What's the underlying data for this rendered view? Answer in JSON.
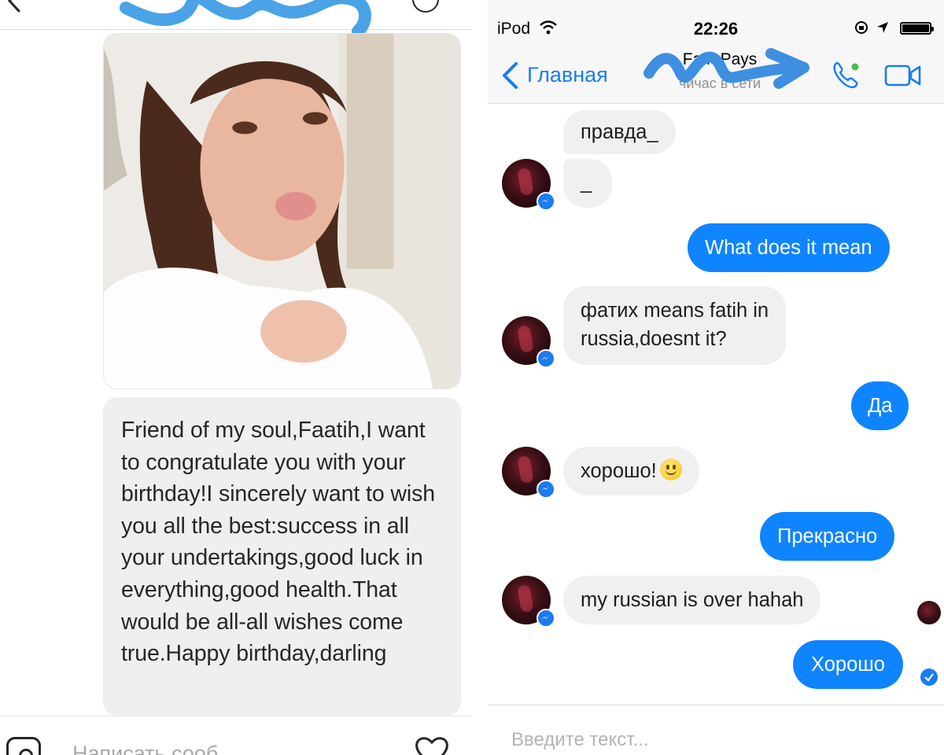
{
  "left_panel": {
    "message_text": "Friend of my soul,Faatih,I want to congratulate you with your birthday!I sincerely want to wish you all the best:success in all your undertakings,good luck in everything,good health.That would be all-all wishes come true.Happy birthday,darling",
    "input_placeholder": "Написать сооб...",
    "icons": [
      "back-icon",
      "info-icon",
      "camera-icon",
      "heart-icon"
    ]
  },
  "right_panel": {
    "status_bar": {
      "carrier": "iPod",
      "time": "22:26"
    },
    "nav": {
      "back_label": "Главная",
      "contact_name": "Fa h Pays",
      "contact_status": "чйчас в сети"
    },
    "messages": [
      {
        "dir": "in",
        "text": "правда_"
      },
      {
        "dir": "in",
        "text": "_"
      },
      {
        "dir": "out",
        "text": "What does it mean"
      },
      {
        "dir": "in",
        "text": "фатих means fatih in"
      },
      {
        "dir": "in",
        "text": "russia,doesnt it?"
      },
      {
        "dir": "out",
        "text": "Да"
      },
      {
        "dir": "in",
        "text": "хорошо!"
      },
      {
        "dir": "out",
        "text": "Прекрасно"
      },
      {
        "dir": "in",
        "text": "my russian is over hahah"
      },
      {
        "dir": "out",
        "text": "Хорошо"
      }
    ],
    "input_placeholder": "Введите текст...",
    "colors": {
      "accent": "#1a7cf1",
      "outgoing_bubble": "#0f84ff",
      "incoming_bubble": "#f1f0f0"
    }
  }
}
